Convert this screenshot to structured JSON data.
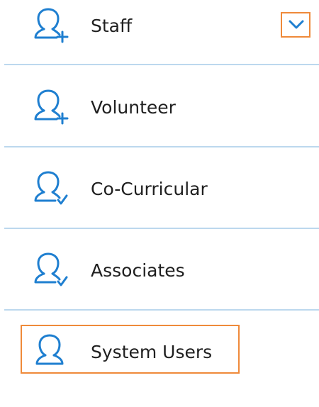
{
  "accent_color": "#1f7fd0",
  "highlight_color": "#ef8a3a",
  "divider_color": "#bcd8ee",
  "menu": {
    "items": [
      {
        "label": "Staff",
        "icon": "user-add-icon",
        "expandable": true,
        "expand_icon": "chevron-down-icon"
      },
      {
        "label": "Volunteer",
        "icon": "user-add-icon"
      },
      {
        "label": "Co-Curricular",
        "icon": "user-check-icon"
      },
      {
        "label": "Associates",
        "icon": "user-check-icon"
      },
      {
        "label": "System Users",
        "icon": "user-icon",
        "highlighted": true
      }
    ]
  }
}
